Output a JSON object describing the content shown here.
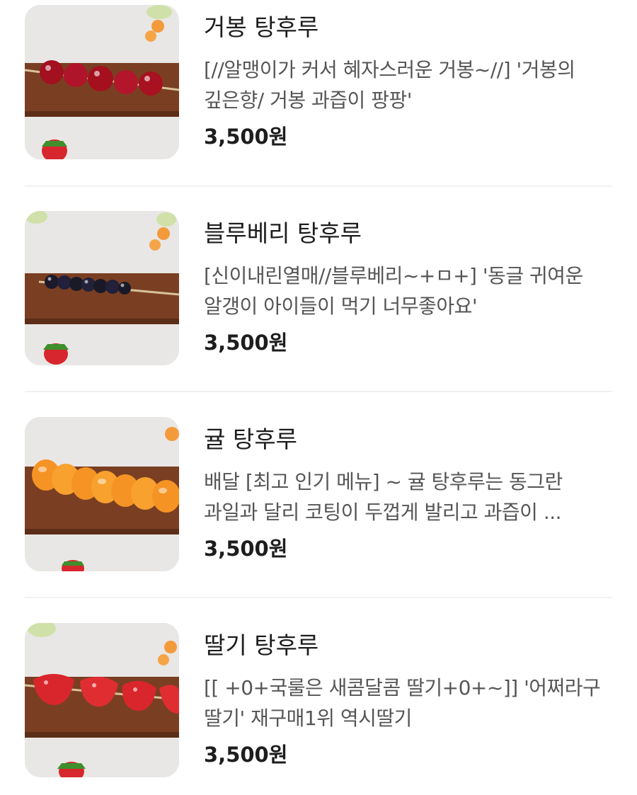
{
  "menu": {
    "items": [
      {
        "name": "거봉 탕후루",
        "description_lines": [
          "[//알맹이가 커서 혜자스러운 거봉~//] '거봉의",
          "깊은향/ 거봉 과즙이 팡팡'"
        ],
        "price": "3,500원",
        "image": "grape-tanghulu-photo"
      },
      {
        "name": "블루베리 탕후루",
        "description_lines": [
          "[신이내린열매//블루베리~+ㅁ+] '동글 귀여운",
          "알갱이 아이들이 먹기 너무좋아요'"
        ],
        "price": "3,500원",
        "image": "blueberry-tanghulu-photo"
      },
      {
        "name": "귤 탕후루",
        "description_lines": [
          "배달 [최고 인기 메뉴] ~ 귤 탕후루는 동그란",
          "과일과 달리 코팅이 두껍게 발리고 과즙이 ..."
        ],
        "price": "3,500원",
        "image": "tangerine-tanghulu-photo"
      },
      {
        "name": "딸기 탕후루",
        "description_lines": [
          "[[ +0+국룰은 새콤달콤 딸기+0+~]] '어쩌라구",
          "딸기' 재구매1위 역시딸기"
        ],
        "price": "3,500원",
        "image": "strawberry-tanghulu-photo"
      }
    ]
  }
}
